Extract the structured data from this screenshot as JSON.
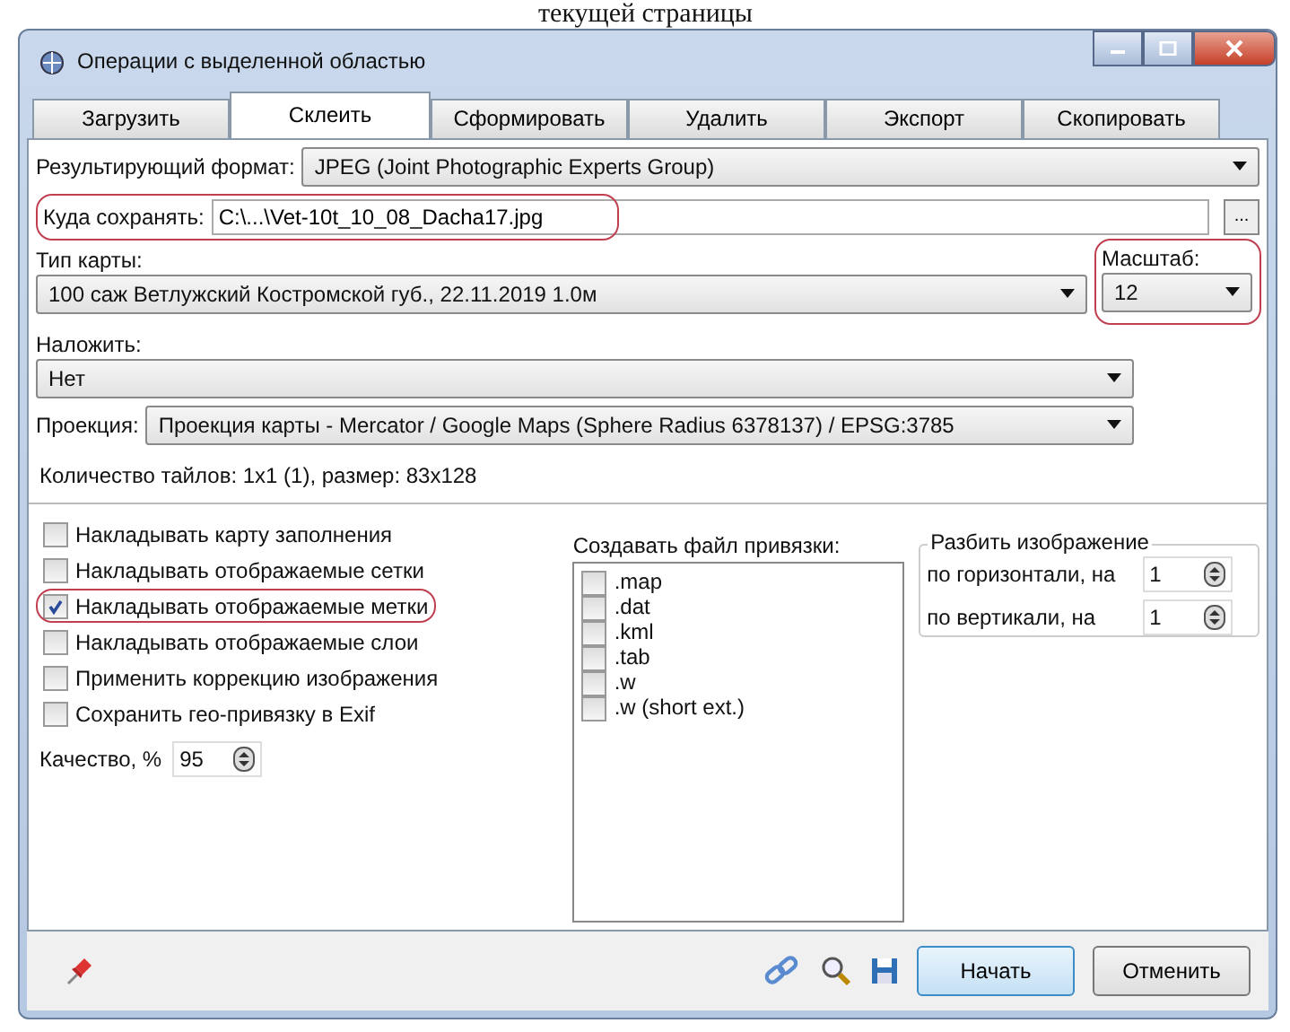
{
  "caption": "текущей страницы",
  "window": {
    "title": "Операции с выделенной областью"
  },
  "tabs": [
    {
      "label": "Загрузить",
      "selected": false
    },
    {
      "label": "Склеить",
      "selected": true
    },
    {
      "label": "Сформировать",
      "selected": false
    },
    {
      "label": "Удалить",
      "selected": false
    },
    {
      "label": "Экспорт",
      "selected": false
    },
    {
      "label": "Скопировать",
      "selected": false
    }
  ],
  "format": {
    "label": "Результирующий формат:",
    "value": "JPEG (Joint Photographic Experts Group)"
  },
  "save_to": {
    "label": "Куда сохранять:",
    "value": "C:\\...\\Vet-10t_10_08_Dacha17.jpg",
    "highlighted": true,
    "browse": "..."
  },
  "map_type": {
    "label": "Тип карты:",
    "value": "100 саж Ветлужский Костромской губ., 22.11.2019 1.0м"
  },
  "scale": {
    "label": "Масштаб:",
    "value": "12",
    "highlighted": true
  },
  "overlay": {
    "label": "Наложить:",
    "value": "Нет"
  },
  "projection": {
    "label": "Проекция:",
    "value": "Проекция карты - Mercator / Google Maps (Sphere Radius 6378137) / EPSG:3785"
  },
  "tile_count": "Количество тайлов: 1x1 (1), размер: 83x128",
  "options": [
    {
      "label": "Накладывать карту заполнения",
      "checked": false,
      "highlighted": false
    },
    {
      "label": "Накладывать отображаемые сетки",
      "checked": false,
      "highlighted": false
    },
    {
      "label": "Накладывать отображаемые метки",
      "checked": true,
      "highlighted": true
    },
    {
      "label": "Накладывать отображаемые слои",
      "checked": false,
      "highlighted": false
    },
    {
      "label": "Применить коррекцию изображения",
      "checked": false,
      "highlighted": false
    },
    {
      "label": "Сохранить гео-привязку в Exif",
      "checked": false,
      "highlighted": false
    }
  ],
  "quality": {
    "label": "Качество, %",
    "value": "95"
  },
  "binding": {
    "label": "Создавать файл привязки:",
    "items": [
      {
        "label": ".map",
        "checked": false
      },
      {
        "label": ".dat",
        "checked": false
      },
      {
        "label": ".kml",
        "checked": false
      },
      {
        "label": ".tab",
        "checked": false
      },
      {
        "label": ".w",
        "checked": false
      },
      {
        "label": ".w (short ext.)",
        "checked": false
      }
    ]
  },
  "split": {
    "title": "Разбить изображение",
    "rows": [
      {
        "label": "по горизонтали, на",
        "value": "1"
      },
      {
        "label": "по вертикали, на",
        "value": "1"
      }
    ]
  },
  "buttons": [
    {
      "label": "Начать",
      "kind": "default"
    },
    {
      "label": "Отменить",
      "kind": "normal"
    }
  ]
}
